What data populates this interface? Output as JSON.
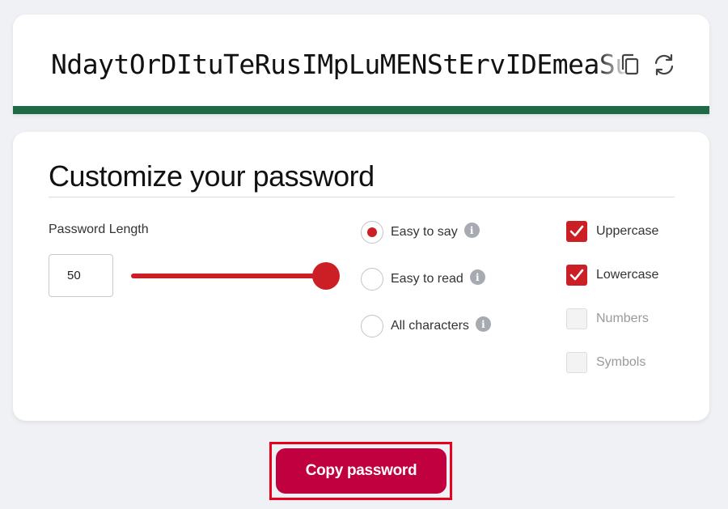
{
  "password": {
    "value": "NdaytOrDItuTeRusIMpLuMENStErvIDEmeaSurE",
    "copy_icon": "copy-icon",
    "refresh_icon": "refresh-icon",
    "strength_color": "#1e6a47"
  },
  "customize": {
    "title": "Customize your password",
    "length_label": "Password Length",
    "length_value": "50",
    "slider_fraction": 1.0,
    "options": [
      {
        "label": "Easy to say",
        "selected": true
      },
      {
        "label": "Easy to read",
        "selected": false
      },
      {
        "label": "All characters",
        "selected": false
      }
    ],
    "checkboxes": [
      {
        "label": "Uppercase",
        "checked": true
      },
      {
        "label": "Lowercase",
        "checked": true
      },
      {
        "label": "Numbers",
        "checked": false
      },
      {
        "label": "Symbols",
        "checked": false
      }
    ],
    "info_icon": "info-icon"
  },
  "copy_button": {
    "label": "Copy password"
  },
  "colors": {
    "accent_red": "#cc1f25",
    "button_crimson": "#c1003f",
    "strength_green": "#1e6a47",
    "highlight_outline": "#e8001c"
  }
}
